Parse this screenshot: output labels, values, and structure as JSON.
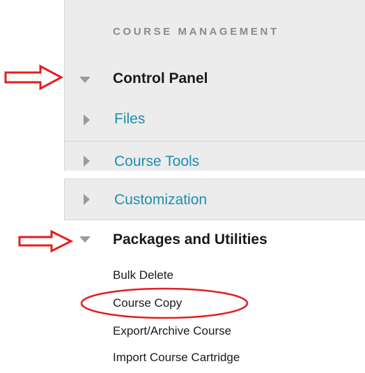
{
  "menu": {
    "section_heading": "COURSE MANAGEMENT",
    "control_panel": {
      "label": "Control Panel",
      "expanded": true,
      "items": [
        {
          "label": "Files",
          "expanded": false
        },
        {
          "label": "Course Tools",
          "expanded": false
        },
        {
          "label": "Customization",
          "expanded": false
        }
      ]
    },
    "packages_utilities": {
      "label": "Packages and Utilities",
      "expanded": true,
      "items": [
        {
          "label": "Bulk Delete"
        },
        {
          "label": "Course Copy"
        },
        {
          "label": "Export/Archive Course"
        },
        {
          "label": "Import Course Cartridge"
        }
      ]
    }
  },
  "annotations": {
    "arrow_color": "#e41e1e",
    "circled_item": "Course Copy"
  },
  "colors": {
    "panel_bg": "#ececec",
    "link": "#1f8eb0",
    "heading": "#8a8a8a",
    "triangle": "#9a9a9a"
  }
}
